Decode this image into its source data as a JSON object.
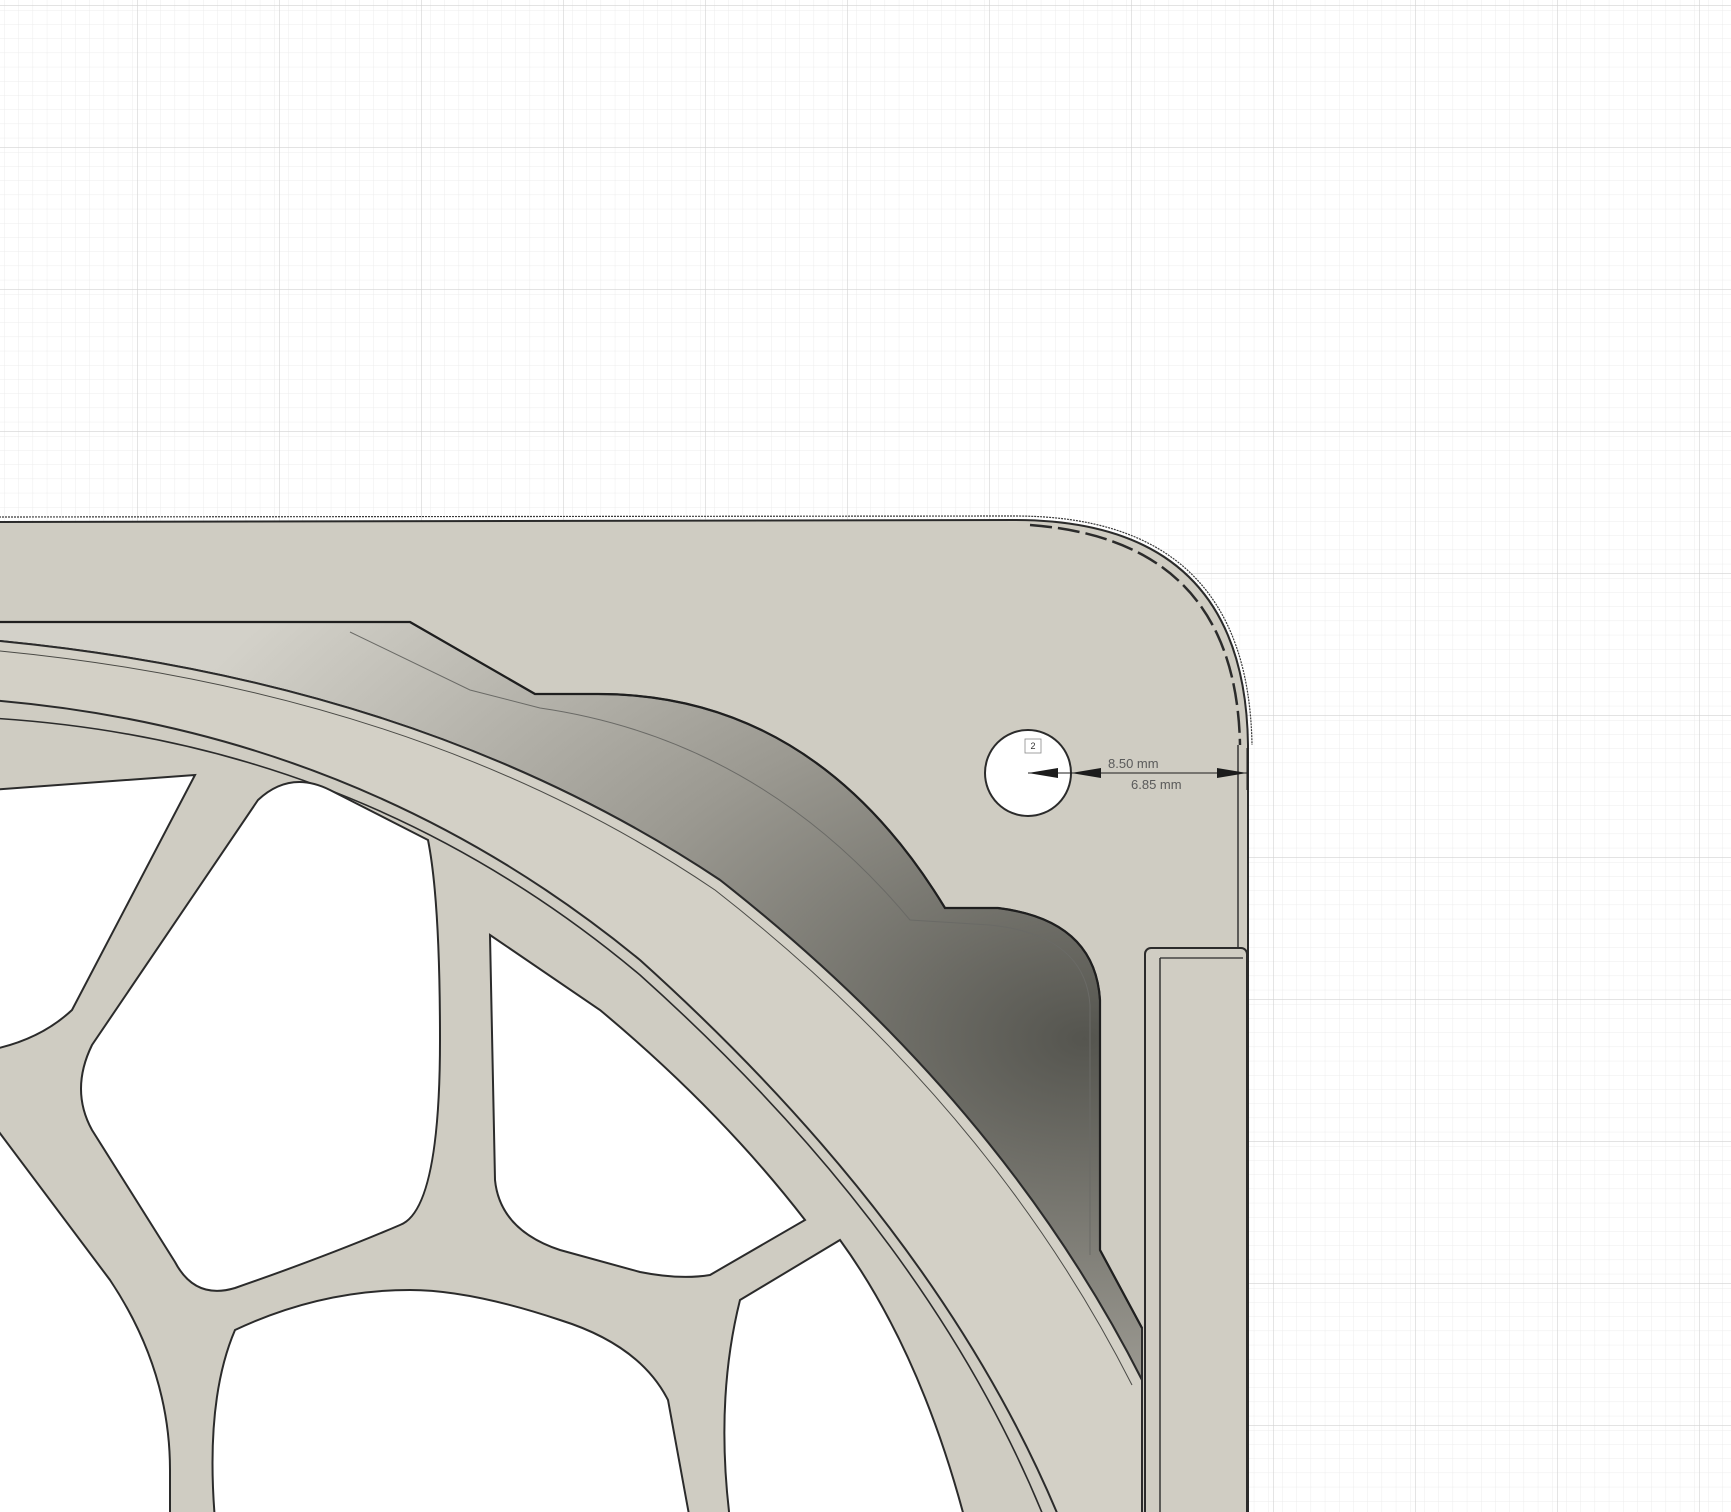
{
  "canvas": {
    "background": "#ffffff",
    "grid_minor_color": "#e6e6e6",
    "grid_major_color": "#cfcfcf"
  },
  "part": {
    "face_color": "#cfccc2",
    "edge_color": "#2b2b2b",
    "shadow_dark": "#5e5e58",
    "shadow_light": "#c9c7bf"
  },
  "dimensions": {
    "dim1_label": "8.50 mm",
    "dim2_label": "6.85 mm",
    "hole_marker": "2",
    "arrow_color": "#1c1c1c"
  }
}
